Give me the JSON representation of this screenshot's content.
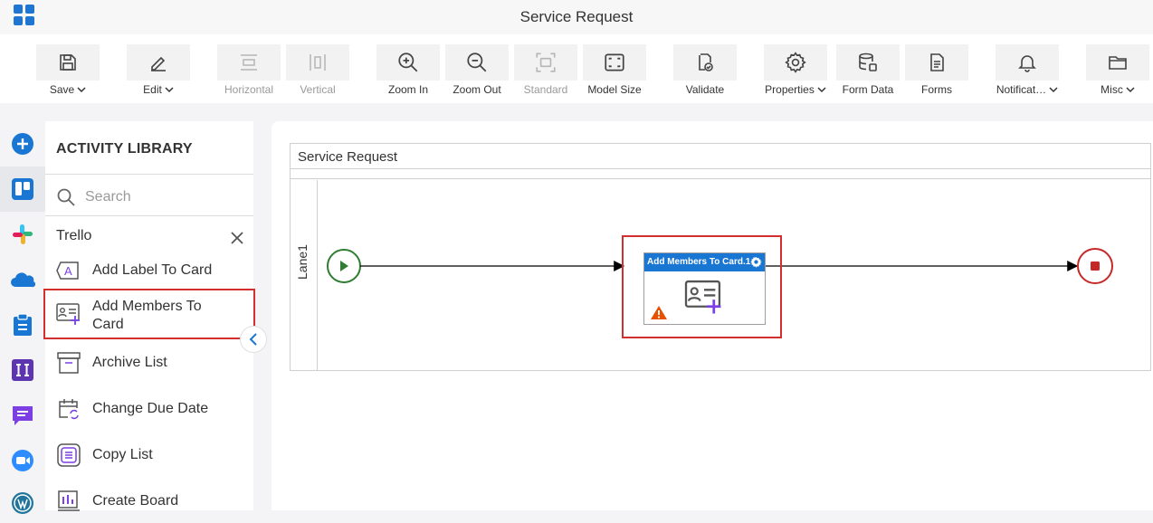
{
  "app": {
    "title": "Service Request"
  },
  "toolbar": {
    "save": "Save",
    "edit": "Edit",
    "horizontal": "Horizontal",
    "vertical": "Vertical",
    "zoom_in": "Zoom In",
    "zoom_out": "Zoom Out",
    "standard": "Standard",
    "model_size": "Model Size",
    "validate": "Validate",
    "properties": "Properties",
    "form_data": "Form Data",
    "forms": "Forms",
    "notifications": "Notificat…",
    "misc": "Misc"
  },
  "library": {
    "title": "ACTIVITY LIBRARY",
    "search_placeholder": "Search",
    "section": "Trello",
    "items": [
      {
        "label": "Add Label To Card",
        "icon": "label-a-icon"
      },
      {
        "label": "Add Members To Card",
        "icon": "add-member-card-icon"
      },
      {
        "label": "Archive List",
        "icon": "archive-icon"
      },
      {
        "label": "Change Due Date",
        "icon": "calendar-change-icon"
      },
      {
        "label": "Copy List",
        "icon": "copy-list-icon"
      },
      {
        "label": "Create Board",
        "icon": "board-icon"
      }
    ]
  },
  "canvas": {
    "pool_title": "Service Request",
    "lane_label": "Lane1",
    "task_title": "Add Members To Card.1"
  },
  "colors": {
    "accent": "#1976d2",
    "highlight": "#d32f2f",
    "start": "#2e7d32",
    "end": "#c62828",
    "warning": "#e65100",
    "purple": "#7b3fe4"
  }
}
